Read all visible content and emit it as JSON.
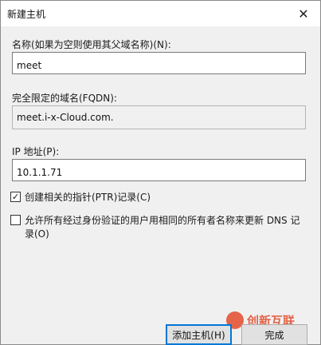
{
  "window": {
    "title": "新建主机",
    "close_glyph": "✕"
  },
  "form": {
    "name_label": "名称(如果为空则使用其父域名称)(N):",
    "name_value": "meet",
    "fqdn_label": "完全限定的域名(FQDN):",
    "fqdn_value": "meet.i-x-Cloud.com.",
    "ip_label": "IP 地址(P):",
    "ip_value": "10.1.1.71",
    "ptr_checkbox": {
      "label": "创建相关的指针(PTR)记录(C)",
      "checked": true,
      "mark": "✓"
    },
    "dns_checkbox": {
      "label": "允许所有经过身份验证的用户用相同的所有者名称来更新 DNS 记录(O)",
      "checked": false,
      "mark": ""
    }
  },
  "buttons": {
    "add_host": "添加主机(H)",
    "done": "完成"
  },
  "watermark": {
    "text": "创新互联",
    "color": "#e24b2c"
  },
  "colors": {
    "focus_border": "#0078d7"
  }
}
